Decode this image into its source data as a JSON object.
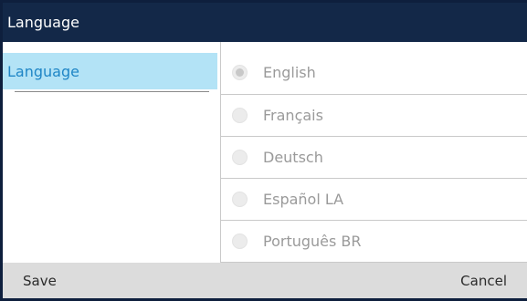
{
  "header": {
    "title": "Language"
  },
  "sidebar": {
    "items": [
      {
        "label": "Language",
        "selected": true
      }
    ]
  },
  "options": [
    {
      "label": "English",
      "selected": true
    },
    {
      "label": "Français",
      "selected": false
    },
    {
      "label": "Deutsch",
      "selected": false
    },
    {
      "label": "Español LA",
      "selected": false
    },
    {
      "label": "Português BR",
      "selected": false
    }
  ],
  "footer": {
    "save_label": "Save",
    "cancel_label": "Cancel"
  },
  "colors": {
    "titlebar": "#132848",
    "sidebar_highlight": "#b3e3f6",
    "sidebar_text": "#1f86c6",
    "footer": "#dcdcdc"
  }
}
